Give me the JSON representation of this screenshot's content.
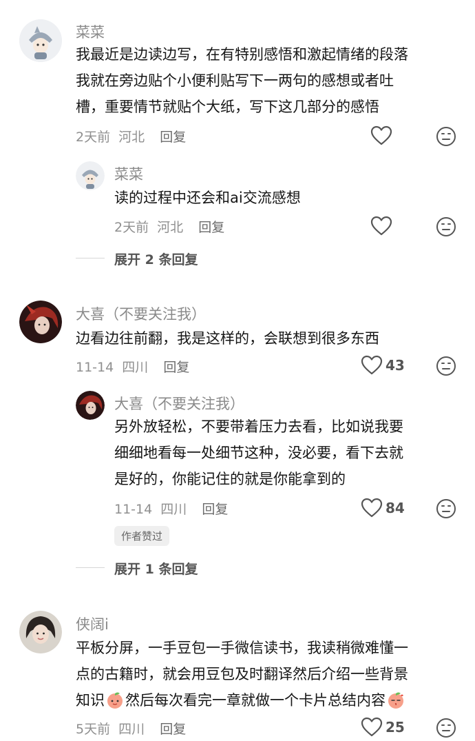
{
  "comments": [
    {
      "author": "菜菜",
      "lines": [
        "我最近是边读边写，在有特别感悟和激起情绪的段落",
        "我就在旁边贴个小便利贴写下一两句的感想或者吐",
        "槽，重要情节就贴个大纸，写下这几部分的感悟"
      ],
      "date": "2天前",
      "region": "河北",
      "reply_label": "回复",
      "likes": "",
      "replies": [
        {
          "author": "菜菜",
          "lines": [
            "读的过程中还会和ai交流感想"
          ],
          "date": "2天前",
          "region": "河北",
          "reply_label": "回复",
          "likes": ""
        }
      ],
      "expand_label": "展开 2 条回复"
    },
    {
      "author": "大喜（不要关注我）",
      "lines": [
        "边看边往前翻，我是这样的，会联想到很多东西"
      ],
      "date": "11-14",
      "region": "四川",
      "reply_label": "回复",
      "likes": "43",
      "replies": [
        {
          "author": "大喜（不要关注我）",
          "lines": [
            "另外放轻松，不要带着压力去看，比如说我要",
            "细细地看每一处细节这种，没必要，看下去就",
            "是好的，你能记住的就是你能拿到的"
          ],
          "date": "11-14",
          "region": "四川",
          "reply_label": "回复",
          "likes": "84",
          "badge": "作者赞过"
        }
      ],
      "expand_label": "展开 1 条回复"
    },
    {
      "author": "侠阔i",
      "lines": [
        "平板分屏，一手豆包一手微信读书，我读稍微难懂一",
        "点的古籍时，就会用豆包及时翻译然后介绍一些背景"
      ],
      "line3_a": "知识",
      "line3_b": "然后每次看完一章就做一个卡片总结内容",
      "date": "5天前",
      "region": "四川",
      "reply_label": "回复",
      "likes": "25"
    }
  ],
  "icons": {
    "like": "heart-outline-icon",
    "dislike": "neutral-face-icon",
    "emoji1": "peach-face-emoji",
    "emoji2": "peach-kiss-emoji"
  }
}
